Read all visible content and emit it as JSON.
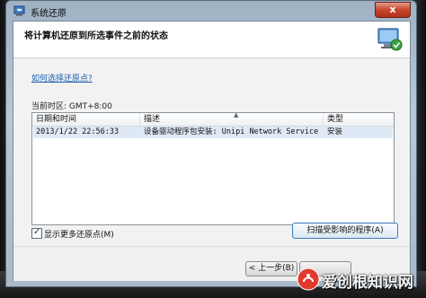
{
  "window": {
    "title": "系统还原",
    "close_glyph": "x",
    "header_title": "将计算机还原到所选事件之前的状态",
    "help_link": "如何选择还原点?",
    "timezone_label": "当前时区: GMT+8:00"
  },
  "restore_points": {
    "columns": [
      "日期和时间",
      "描述",
      "类型"
    ],
    "rows": [
      {
        "datetime": "2013/1/22 22:56:33",
        "description": "设备驱动程序包安装: Unipi Network Service",
        "type": "安装"
      }
    ]
  },
  "options": {
    "show_more_label": "显示更多还原点(M)",
    "show_more_checked": true,
    "scan_button": "扫描受影响的程序(A)"
  },
  "footer": {
    "back_button": "< 上一步(B)"
  },
  "watermark": {
    "text": "爱创根知识网"
  }
}
